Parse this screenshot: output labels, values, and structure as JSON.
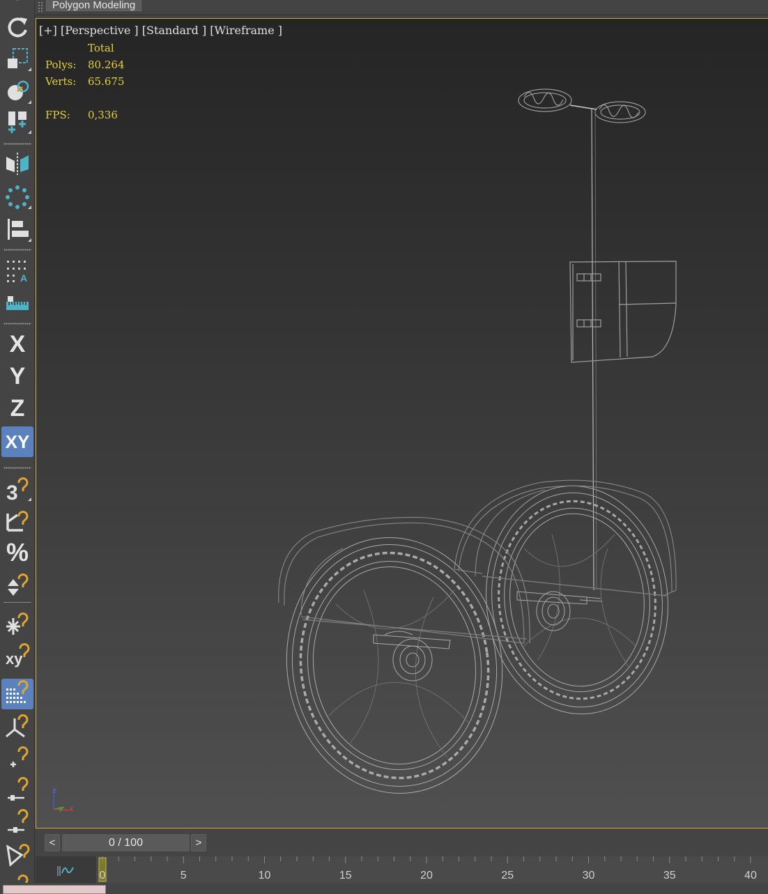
{
  "ribbon": {
    "tab_label": "Polygon Modeling"
  },
  "viewport": {
    "label": "[+] [Perspective ] [Standard ] [Wireframe ]",
    "stats": {
      "total_header": "Total",
      "polys_label": "Polys:",
      "polys_value": "80.264",
      "verts_label": "Verts:",
      "verts_value": "65.675",
      "fps_label": "FPS:",
      "fps_value": "0,336"
    },
    "axis_labels": {
      "x": "x",
      "y": "y",
      "z": "z"
    }
  },
  "toolbar": {
    "x_label": "X",
    "y_label": "Y",
    "z_label": "Z",
    "xy_label": "XY",
    "snap3_label": "3",
    "percent_label": "%",
    "xy_small_label": "xy",
    "tools": [
      "select-arrow-icon",
      "rotate-icon",
      "scale-region-icon",
      "paint-select-icon",
      "place-icon",
      "mirror-icon",
      "array-icon",
      "align-icon",
      "spacing-tool-icon",
      "measure-icon",
      "axis-x-icon",
      "axis-y-icon",
      "axis-z-icon",
      "axis-xy-icon",
      "snap-3d-icon",
      "angle-snap-icon",
      "percent-snap-icon",
      "spinner-snap-icon",
      "snap-frozen-icon",
      "snap-xy-icon",
      "grid-snap-icon",
      "pivot-snap-icon",
      "vertex-snap-icon",
      "edge-snap-icon",
      "midpoint-snap-icon",
      "face-snap-icon"
    ]
  },
  "time_slider": {
    "prev_label": "<",
    "next_label": ">",
    "frame_display": "0 / 100",
    "current_frame": 0,
    "total_frames": 100
  },
  "track_bar": {
    "tick_labels": [
      "0",
      "5",
      "10",
      "15",
      "20",
      "25",
      "30",
      "35",
      "40"
    ]
  },
  "colors": {
    "accent": "#5b82bd",
    "stats_text": "#e6cf3a",
    "viewport_border": "#c9a84a",
    "snap_magnet": "#e0a630"
  }
}
